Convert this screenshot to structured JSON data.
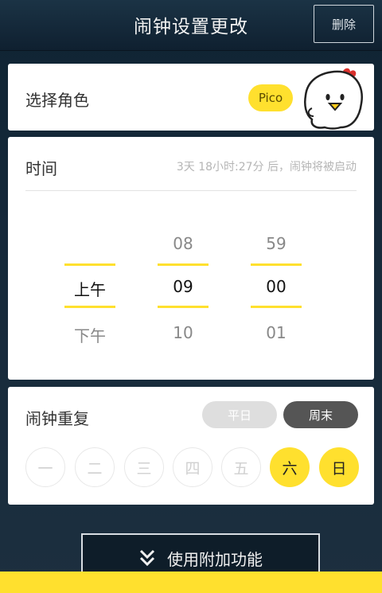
{
  "header": {
    "title": "闹钟设置更改",
    "delete_label": "删除"
  },
  "character": {
    "label": "选择角色",
    "badge": "Pico",
    "mascot_icon": "chick-mascot"
  },
  "time": {
    "label": "时间",
    "countdown": "3天 18小时:27分 后，闹钟将被启动",
    "ampm": {
      "prev": "",
      "selected": "上午",
      "next": "下午"
    },
    "hour": {
      "prev": "08",
      "selected": "09",
      "next": "10"
    },
    "minute": {
      "prev": "59",
      "selected": "00",
      "next": "01"
    }
  },
  "repeat": {
    "label": "闹钟重复",
    "weekday_label": "平日",
    "weekend_label": "周末",
    "days": [
      {
        "label": "一",
        "active": false
      },
      {
        "label": "二",
        "active": false
      },
      {
        "label": "三",
        "active": false
      },
      {
        "label": "四",
        "active": false
      },
      {
        "label": "五",
        "active": false
      },
      {
        "label": "六",
        "active": true
      },
      {
        "label": "日",
        "active": true
      }
    ]
  },
  "addon": {
    "label": "使用附加功能"
  },
  "colors": {
    "accent": "#ffe02e",
    "header_bg": "#0f2030"
  }
}
